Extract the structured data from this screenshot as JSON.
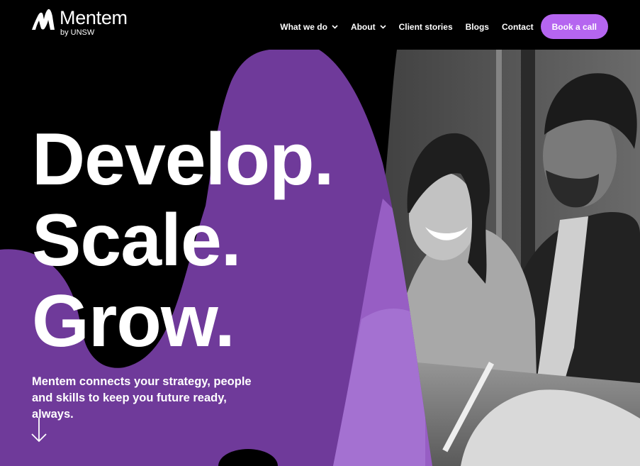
{
  "brand": {
    "name": "Mentem",
    "sub": "by UNSW",
    "logo_icon": "mentem-m-icon"
  },
  "nav": {
    "items": [
      {
        "label": "What we do",
        "dropdown": true
      },
      {
        "label": "About",
        "dropdown": true
      },
      {
        "label": "Client stories",
        "dropdown": false
      },
      {
        "label": "Blogs",
        "dropdown": false
      },
      {
        "label": "Contact",
        "dropdown": false
      }
    ],
    "cta": "Book a call"
  },
  "hero": {
    "headline": [
      "Develop.",
      "Scale.",
      "Grow."
    ],
    "subtext": "Mentem connects your strategy, people and skills to keep you future ready, always.",
    "scroll_icon": "arrow-down-icon",
    "image_subject": "hero-photo"
  },
  "colors": {
    "background": "#000000",
    "accent_purple": "#6f3a9a",
    "cta": "#b565f0",
    "text": "#ffffff"
  }
}
